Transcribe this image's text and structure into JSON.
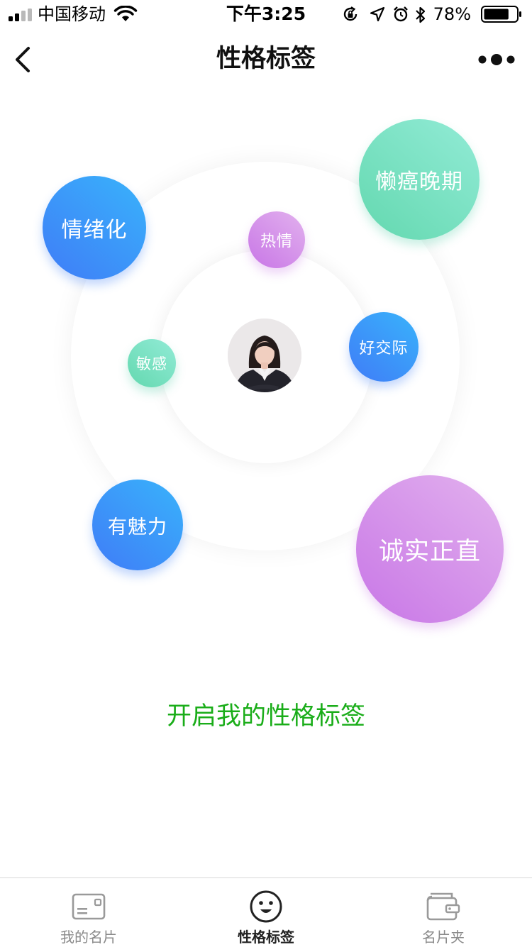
{
  "status_bar": {
    "carrier": "中国移动",
    "time": "下午3:25",
    "battery_percent": "78%",
    "battery_level": 0.78,
    "icons": [
      "signal-icon",
      "wifi-icon",
      "orientation-lock-icon",
      "location-icon",
      "alarm-icon",
      "bluetooth-icon",
      "battery-icon"
    ]
  },
  "nav": {
    "title": "性格标签",
    "back_icon": "chevron-left-icon",
    "more_icon": "more-dots-icon"
  },
  "tags": [
    {
      "label": "情绪化"
    },
    {
      "label": "懒癌晚期"
    },
    {
      "label": "热情"
    },
    {
      "label": "好交际"
    },
    {
      "label": "敏感"
    },
    {
      "label": "有魅力"
    },
    {
      "label": "诚实正直"
    }
  ],
  "cta": {
    "label": "开启我的性格标签"
  },
  "tab_bar": {
    "tabs": [
      {
        "label": "我的名片",
        "icon": "card-icon",
        "active": false
      },
      {
        "label": "性格标签",
        "icon": "smile-face-icon",
        "active": true
      },
      {
        "label": "名片夹",
        "icon": "wallet-icon",
        "active": false
      }
    ]
  },
  "colors": {
    "accent_green": "#1aad19",
    "bubble_blue": "#3f7cf7",
    "bubble_green": "#63d8af",
    "bubble_purple": "#c876e6",
    "tab_inactive": "#8a8a8a",
    "tab_active": "#222222"
  }
}
